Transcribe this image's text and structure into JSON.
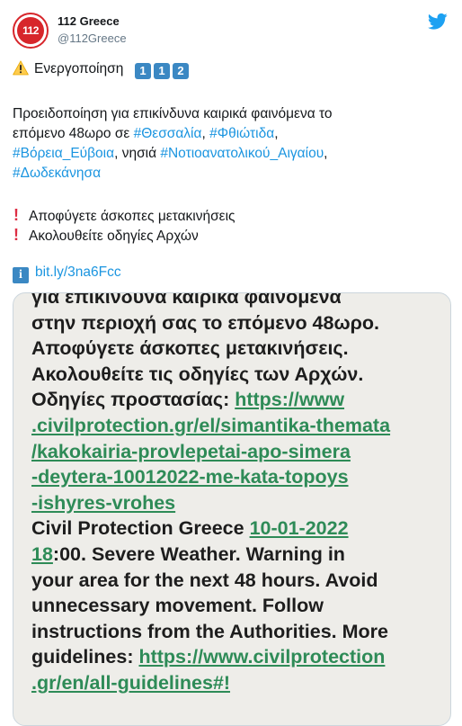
{
  "user": {
    "avatar_text": "112",
    "name": "112 Greece",
    "handle": "@112Greece"
  },
  "icons": {
    "bird": "twitter-bird-icon",
    "warning": "warning-emoji-icon",
    "exclamation": "red-exclamation-icon",
    "info": "information-icon",
    "keycaps": [
      "1",
      "1",
      "2"
    ]
  },
  "tweet": {
    "activation": "Ενεργοποίηση",
    "line1": "Προειδοποίηση για επικίνδυνα καιρικά φαινόμενα το",
    "line2_pre": "επόμενο 48ωρο σε ",
    "tag_thessaly": "#Θεσσαλία",
    "comma1": ", ",
    "tag_fthiotida": "#Φθιώτιδα",
    "comma2": ",",
    "tag_evia": "#Βόρεια_Εύβοια",
    "islands": ", νησιά ",
    "tag_aegean": "#Νοτιοανατολικού_Αιγαίου",
    "comma3": ",",
    "tag_dodecanese": "#Δωδεκάνησα",
    "bullet1": "Αποφύγετε άσκοπες μετακινήσεις",
    "bullet2": "Ακολουθείτε οδηγίες Αρχών",
    "link": "bit.ly/3na6Fcc"
  },
  "sms": {
    "l1": "για επικίνδυνα καιρικά φαινόμενα",
    "l2": "στην περιοχή σας το επόμενο 48ωρο.",
    "l3": "Αποφύγετε άσκοπες μετακινήσεις.",
    "l4": "Ακολουθείτε τις οδηγίες των Αρχών.",
    "l5_pre": "Οδηγίες προστασίας: ",
    "l5_link": "https://www",
    "l6": ".civilprotection.gr/el/simantika-themata",
    "l7": "/kakokairia-provlepetai-apo-simera",
    "l8": "-deytera-10012022-me-kata-topoys",
    "l9": "-ishyres-vrohes",
    "l10_pre": "Civil Protection Greece ",
    "l10_date": "10-01-2022",
    "l11_time": "18",
    "l11_rest": ":00. Severe Weather. Warning in",
    "l12": "your area for the next 48 hours. Avoid",
    "l13": "unnecessary movement. Follow",
    "l14": "instructions from the Authorities. More",
    "l15_pre": "guidelines: ",
    "l15_link": "https://www.civilprotection",
    "l16": ".gr/en/all-guidelines#!"
  },
  "colors": {
    "link": "#1b95e0",
    "brand_red": "#d7262b",
    "keycap_blue": "#3b88c3",
    "sms_link": "#2e8b57",
    "sms_bg": "#eeede9"
  }
}
